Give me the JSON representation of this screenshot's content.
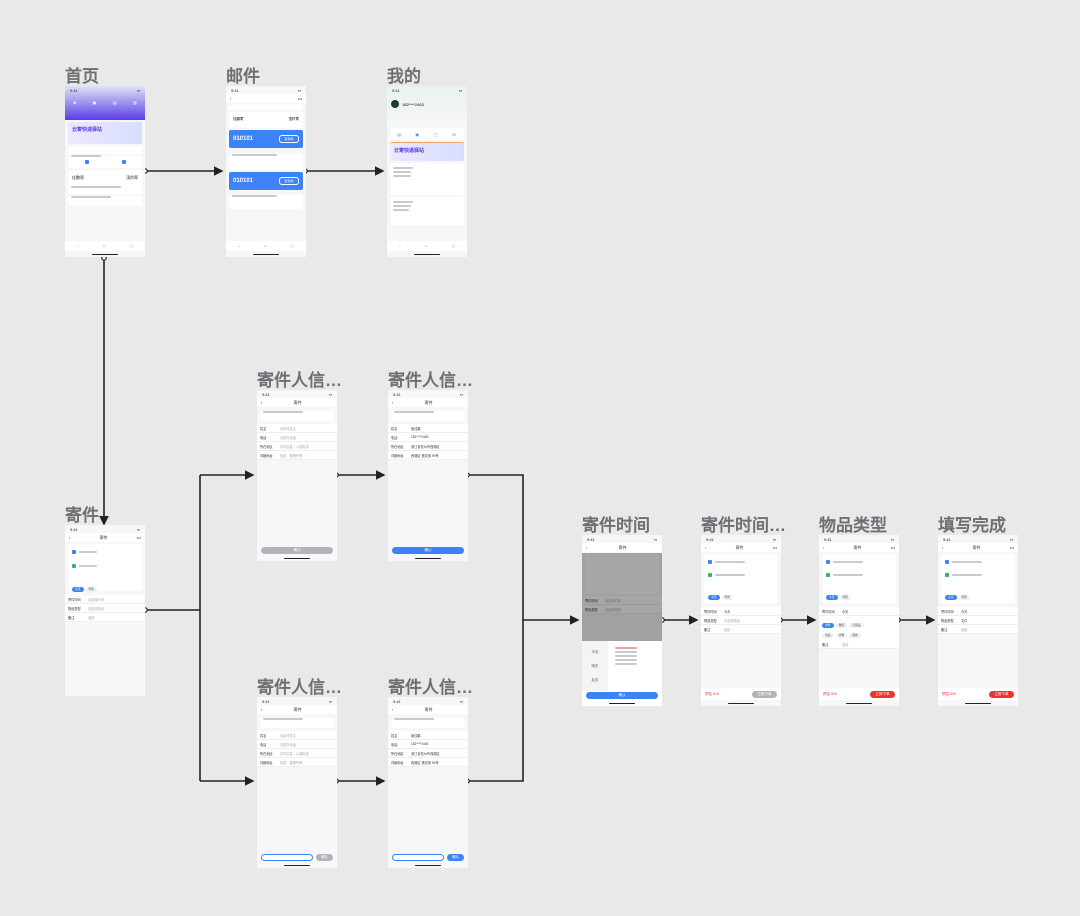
{
  "colors": {
    "accent": "#3e82f7",
    "danger": "#f0342a",
    "connector": "#222222",
    "label": "#6f6f73",
    "canvas": "#e9e9ea"
  },
  "labels": {
    "home": "首页",
    "mail": "邮件",
    "mine": "我的",
    "send": "寄件",
    "sender1": "寄件人信…",
    "sender2": "寄件人信…",
    "sender3": "寄件人信…",
    "sender4": "寄件人信…",
    "time": "寄件时间",
    "time2": "寄件时间…",
    "itemtype": "物品类型",
    "done": "填写完成"
  },
  "screens": {
    "status_time": "9:41",
    "nav_title": "寄件",
    "home": {
      "banner": "云寄快递驿站",
      "card_from": "佳鹏寄",
      "card_to": "顶羚寄"
    },
    "mail": {
      "code": "010101",
      "code2": "010101",
      "btn": "取件码",
      "from": "佳鹏寄",
      "to": "顶羚寄"
    },
    "mine": {
      "phone": "182****2463",
      "banner": "云寄快递驿站"
    },
    "form": {
      "k1": "姓名",
      "k2": "电话",
      "k3": "所在地区",
      "k4": "详细地址",
      "v1": "请填写姓名",
      "v2": "请填写电话",
      "v3": "省市区县、乡镇街道",
      "v4": "街道、楼牌号等",
      "fv1": "吴佳鹏",
      "fv2": "182****2463",
      "fv3": "浙江省杭州市西湖区",
      "fv4": "西湖区 莲花街 99号",
      "confirm": "确认"
    },
    "order": {
      "sender_tag": "寄",
      "receiver_tag": "收",
      "k1": "寄件时间",
      "k2": "物品类型",
      "k3": "备注",
      "v1": "请选择时间",
      "v2": "请选择物品",
      "v3": "选填",
      "price": "预估 ¥15",
      "submit": "立即下单"
    },
    "chips": [
      "今天",
      "明天",
      "后天"
    ],
    "item_chips": [
      "文件",
      "数码",
      "日用品",
      "食品",
      "衣物",
      "其他"
    ]
  }
}
